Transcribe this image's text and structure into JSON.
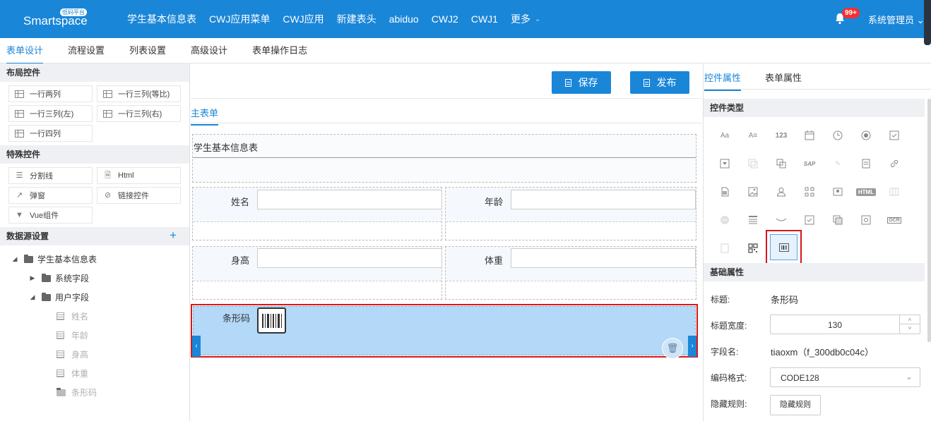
{
  "app": {
    "logo_text": "Smartspace",
    "logo_badge": "低码平台",
    "nav": [
      "学生基本信息表",
      "CWJ应用菜单",
      "CWJ应用",
      "新建表头",
      "abiduo",
      "CWJ2",
      "CWJ1"
    ],
    "nav_more": "更多",
    "notif_count": "99+",
    "user": "系统管理员"
  },
  "subtabs": [
    "表单设计",
    "流程设置",
    "列表设置",
    "高级设计",
    "表单操作日志"
  ],
  "left": {
    "layout_title": "布局控件",
    "layout_items": [
      "一行两列",
      "一行三列(等比)",
      "一行三列(左)",
      "一行三列(右)",
      "一行四列"
    ],
    "special_title": "特殊控件",
    "special_items": [
      "分割线",
      "Html",
      "弹窗",
      "链接控件",
      "Vue组件"
    ],
    "datasource_title": "数据源设置",
    "add_icon": "+",
    "tree": {
      "root": "学生基本信息表",
      "system": "系统字段",
      "user": "用户字段",
      "fields": [
        "姓名",
        "年龄",
        "身高",
        "体重",
        "条形码"
      ]
    }
  },
  "center": {
    "save": "保存",
    "publish": "发布",
    "tab": "主表单",
    "form_title": "学生基本信息表",
    "fields": {
      "name": "姓名",
      "age": "年龄",
      "height": "身高",
      "weight": "体重",
      "barcode": "条形码"
    }
  },
  "right": {
    "tabs": [
      "控件属性",
      "表单属性"
    ],
    "type_title": "控件类型",
    "icons": {
      "row1": [
        "Aa",
        "A≡",
        "123"
      ],
      "html": "HTML",
      "ocr": "OCR",
      "sap": "SAP"
    },
    "basic_title": "基础属性",
    "props": {
      "title_label": "标题:",
      "title_value": "条形码",
      "width_label": "标题宽度:",
      "width_value": "130",
      "field_label": "字段名:",
      "field_value": "tiaoxm（f_300db0c04c）",
      "format_label": "编码格式:",
      "format_value": "CODE128",
      "hide_label": "隐藏规则:",
      "hide_button": "隐藏规则"
    }
  },
  "colors": {
    "primary": "#1a86d8",
    "highlight": "#d9151b",
    "selected_row": "#b3d8f8"
  }
}
